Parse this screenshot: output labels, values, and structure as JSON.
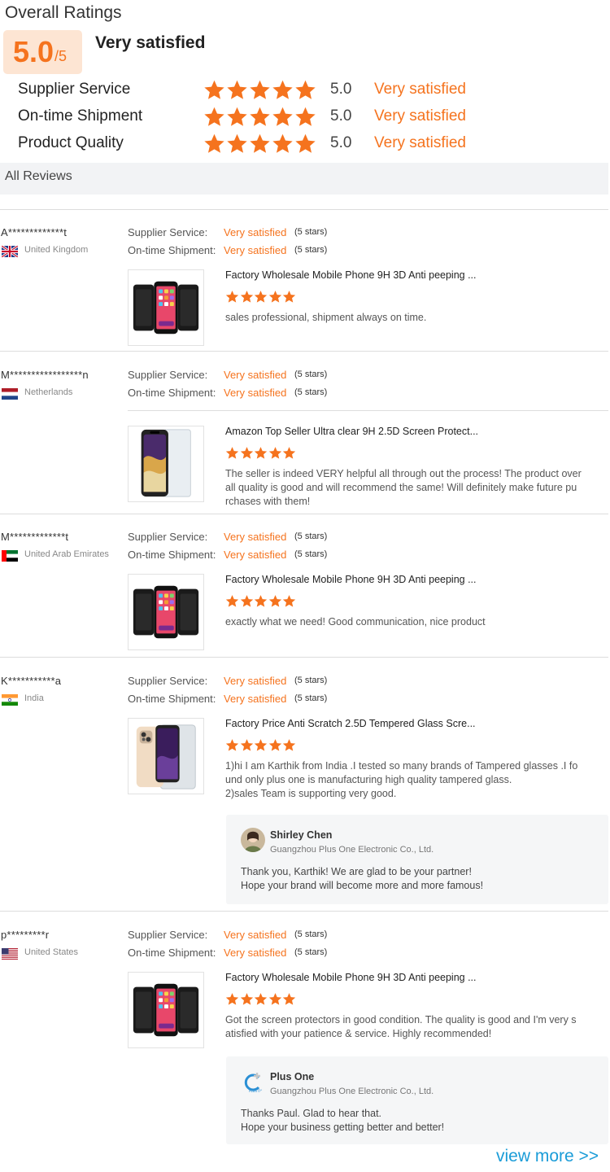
{
  "overall": {
    "title": "Overall Ratings",
    "score": "5.0",
    "out_of": "/5",
    "level": "Very satisfied"
  },
  "categories": [
    {
      "label": "Supplier Service",
      "score": "5.0",
      "level": "Very satisfied",
      "stars": 5
    },
    {
      "label": "On-time Shipment",
      "score": "5.0",
      "level": "Very satisfied",
      "stars": 5
    },
    {
      "label": "Product Quality",
      "score": "5.0",
      "level": "Very satisfied",
      "stars": 5
    }
  ],
  "all_reviews_label": "All Reviews",
  "labels": {
    "supplier_service": "Supplier Service:",
    "ontime_shipment": "On-time Shipment:",
    "very_satisfied": "Very satisfied",
    "five_stars": "(5 stars)"
  },
  "reviews": [
    {
      "name": "A*************t",
      "country": "United Kingdom",
      "flag": "uk-flag",
      "product_title": "Factory Wholesale Mobile Phone 9H 3D Anti peeping ...",
      "product_image": "privacy-screen-protector-phones",
      "text": "sales professional, shipment always on time."
    },
    {
      "name": "M*****************n",
      "country": "Netherlands",
      "flag": "netherlands-flag",
      "product_title": "Amazon Top Seller Ultra clear 9H 2.5D Screen Protect...",
      "product_image": "clear-screen-protector-phone",
      "text": "The seller is indeed VERY helpful all through out the process! The product over\nall quality is good and will recommend the same! Will definitely make future pu\nrchases with them!"
    },
    {
      "name": "M*************t",
      "country": "United Arab Emirates",
      "flag": "uae-flag",
      "product_title": "Factory Wholesale Mobile Phone 9H 3D Anti peeping ...",
      "product_image": "privacy-screen-protector-phones",
      "text": "exactly what we need! Good communication, nice product"
    },
    {
      "name": "K***********a",
      "country": "India",
      "flag": "india-flag",
      "product_title": "Factory Price Anti Scratch 2.5D Tempered Glass Scre...",
      "product_image": "tempered-glass-phone-gold",
      "text": "1)hi I am Karthik from India .I tested so many  brands of Tampered glasses .I fo\nund only plus one  is manufacturing high quality tampered glass.\n2)sales Team is supporting very good.",
      "reply": {
        "name": "Shirley Chen",
        "company": "Guangzhou Plus One Electronic Co., Ltd.",
        "avatar": "person-avatar",
        "text": "Thank you, Karthik! We are glad to be your partner!\nHope your brand will become more and more famous!"
      }
    },
    {
      "name": "p*********r",
      "country": "United States",
      "flag": "usa-flag",
      "product_title": "Factory Wholesale Mobile Phone 9H 3D Anti peeping ...",
      "product_image": "privacy-screen-protector-phones",
      "text": "Got the screen protectors in good condition. The quality is good and I'm very s\natisfied with your patience & service. Highly recommended!",
      "reply": {
        "name": "Plus One",
        "company": "Guangzhou Plus One Electronic Co., Ltd.",
        "avatar": "plus-one-logo",
        "text": "Thanks Paul. Glad to hear that.\nHope your business getting better and better!"
      }
    }
  ],
  "view_more": "view more >>",
  "colors": {
    "accent": "#f5731e",
    "link": "#1a9cd8",
    "score_bg": "#fde5d3"
  }
}
